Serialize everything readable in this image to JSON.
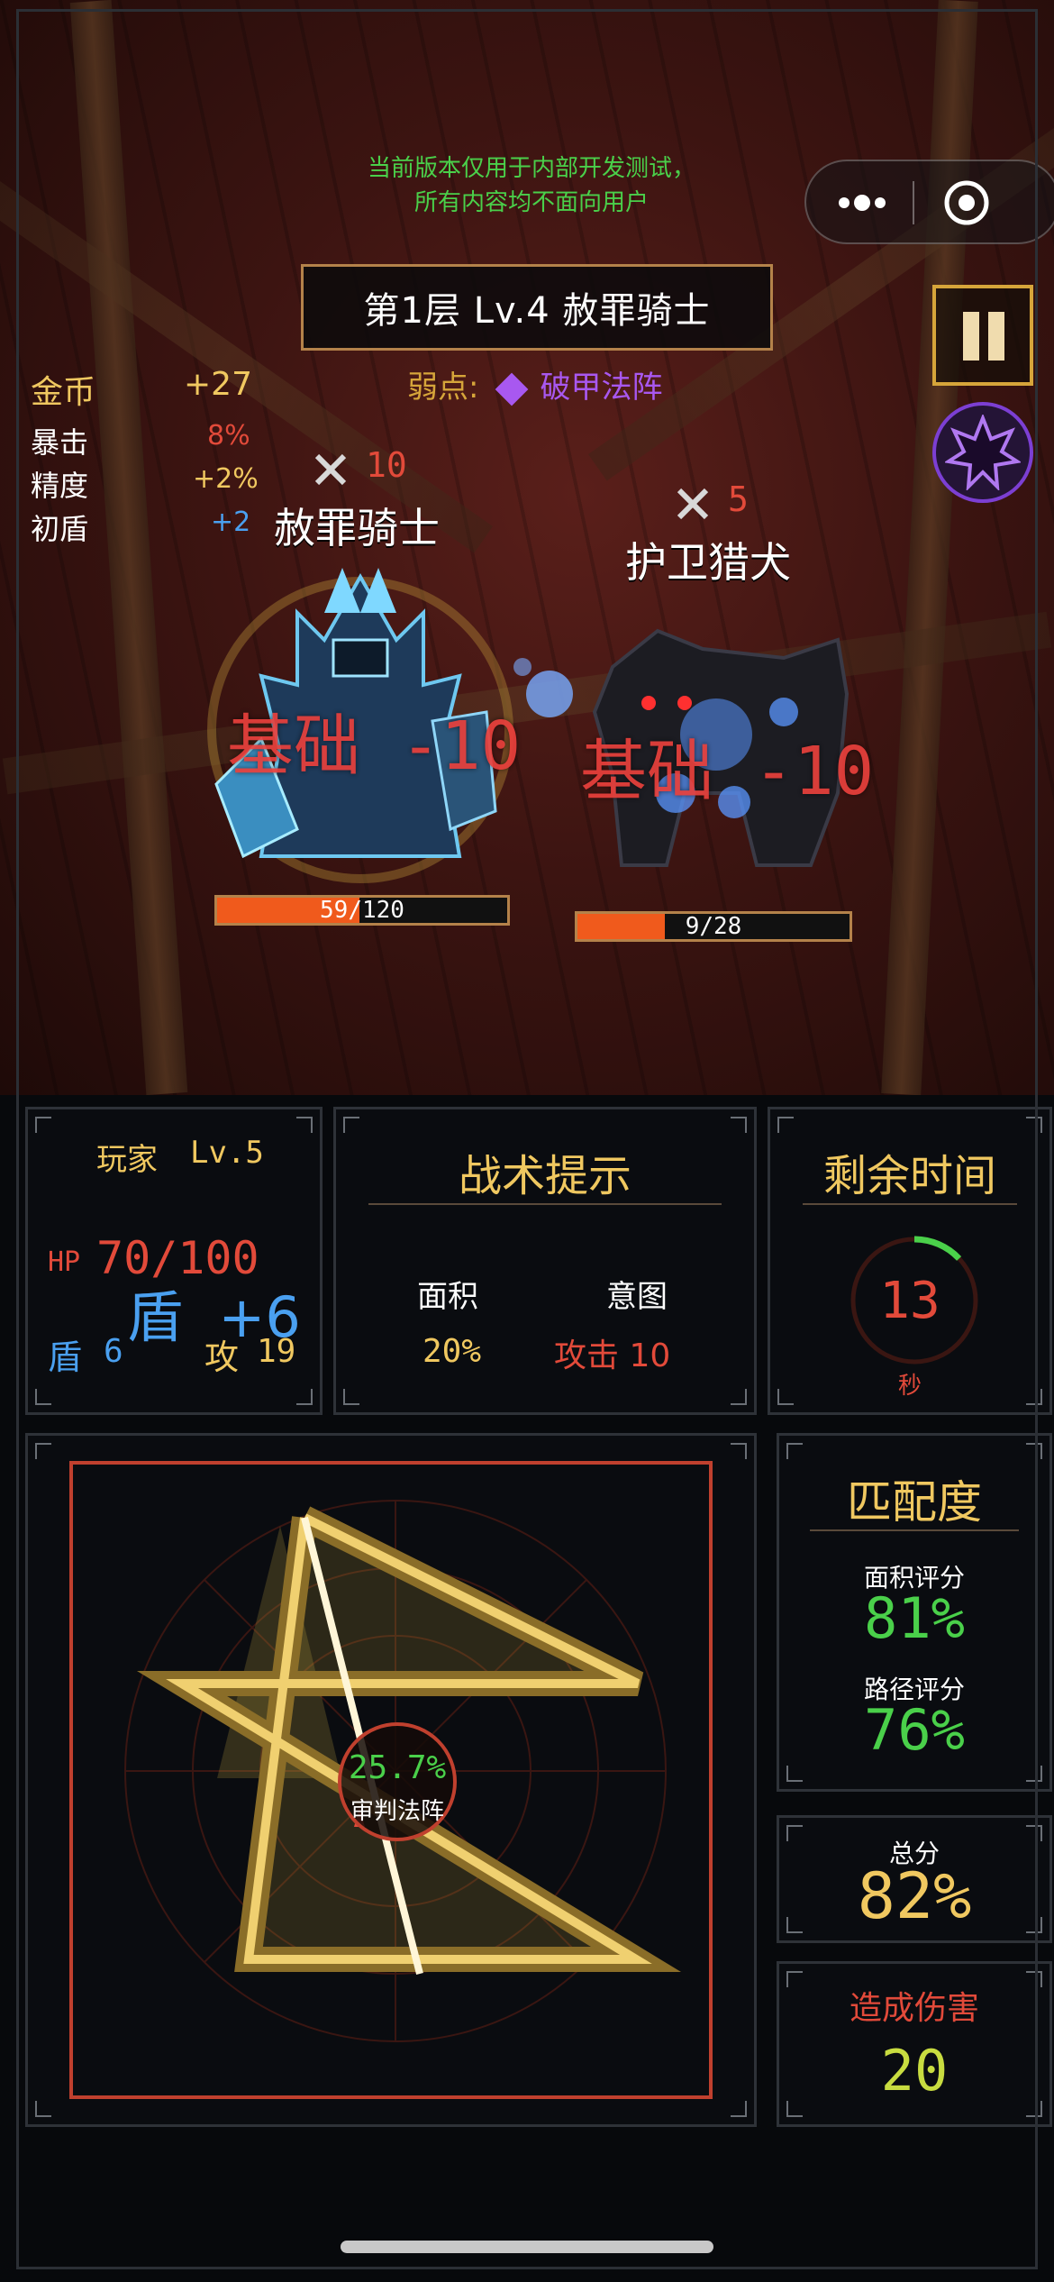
{
  "notice": {
    "line1": "当前版本仅用于内部开发测试，",
    "line2": "所有内容均不面向用户"
  },
  "level_title": "第1层   Lv.4  赦罪骑士",
  "weakness": {
    "label": "弱点:",
    "value": "破甲法阵",
    "color": "#a858f0"
  },
  "stats": {
    "gold_label": "金币",
    "gold_value": "+27",
    "crit_label": "暴击",
    "crit_value": "8%",
    "precision_label": "精度",
    "precision_value": "+2%",
    "shield_label": "初盾",
    "shield_value": "+2"
  },
  "enemies": [
    {
      "name": "赦罪骑士",
      "attack": "10",
      "hp_text": "59/120",
      "hp_fraction": 0.49,
      "damage_float": "基础 -10"
    },
    {
      "name": "护卫猎犬",
      "attack": "5",
      "hp_text": "9/28",
      "hp_fraction": 0.32,
      "damage_float": "基础 -10"
    }
  ],
  "player": {
    "name": "玩家",
    "level": "Lv.5",
    "hp_label": "HP",
    "hp_value": "70/100",
    "shield_float": "盾  +6",
    "shield_label": "盾",
    "shield_value": "6",
    "attack_label": "攻",
    "attack_value": "19"
  },
  "tactics": {
    "title": "战术提示",
    "area_label": "面积",
    "area_value": "20%",
    "intent_label": "意图",
    "intent_value": "攻击 10"
  },
  "timer": {
    "title": "剩余时间",
    "value": "13",
    "unit": "秒",
    "remaining_fraction": 0.13
  },
  "sigil": {
    "percent": "25.7%",
    "name": "审判法阵"
  },
  "match": {
    "title": "匹配度",
    "area_label": "面积评分",
    "area_value": "81%",
    "path_label": "路径评分",
    "path_value": "76%"
  },
  "total": {
    "label": "总分",
    "value": "82%"
  },
  "damage": {
    "label": "造成伤害",
    "value": "20"
  },
  "colors": {
    "gold": "#f0c860",
    "green": "#4ad04a",
    "red": "#e24a3a",
    "blue": "#4aa0f0",
    "accent_frame": "#b4824a"
  },
  "icons": {
    "menu": "more-dots-icon",
    "close": "target-circle-icon",
    "pause": "pause-icon",
    "skill": "octagram-icon",
    "sword": "crossed-swords-icon"
  }
}
